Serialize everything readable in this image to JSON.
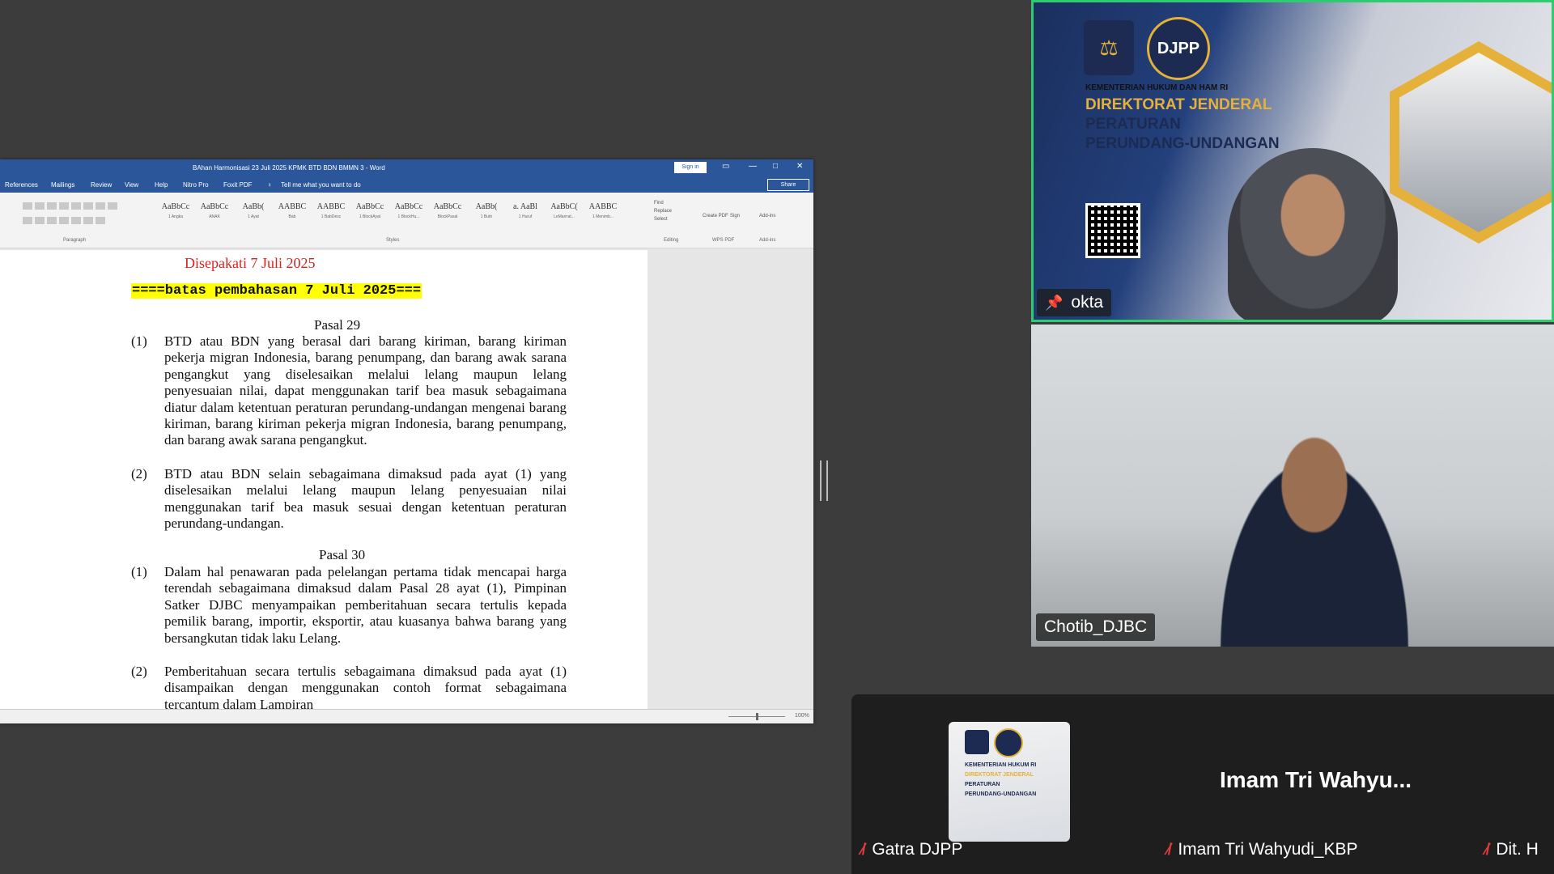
{
  "word": {
    "title": "BAhan Harmonisasi 23 Juli 2025 KPMK BTD BDN BMMN 3 - Word",
    "sign_in": "Sign in",
    "share": "Share",
    "menu": [
      "References",
      "Mailings",
      "Review",
      "View",
      "Help",
      "Nitro Pro",
      "Foxit PDF"
    ],
    "tell_me": "Tell me what you want to do",
    "styles": [
      {
        "sample": "AaBbCc",
        "name": "1 Angka"
      },
      {
        "sample": "AaBbCc",
        "name": "ANAK"
      },
      {
        "sample": "AaBb(",
        "name": "1 Ayat"
      },
      {
        "sample": "AABBC",
        "name": "Bab"
      },
      {
        "sample": "AABBC",
        "name": "1 BabDesc"
      },
      {
        "sample": "AaBbCc",
        "name": "1 BlockAyat"
      },
      {
        "sample": "AaBbCc",
        "name": "1 BlockHu..."
      },
      {
        "sample": "AaBbCc",
        "name": "BlockPasal"
      },
      {
        "sample": "AaBb(",
        "name": "1 Butir"
      },
      {
        "sample": "a. AaBl",
        "name": "1 Huruf"
      },
      {
        "sample": "AaBbC(",
        "name": "LeMarrrat..."
      },
      {
        "sample": "AABBC",
        "name": "1 Menimb..."
      }
    ],
    "groups": {
      "paragraph": "Paragraph",
      "styles": "Styles",
      "editing": "Editing",
      "wps_pdf": "WPS PDF",
      "add_ins": "Add-ins"
    },
    "tools": {
      "find": "Find",
      "replace": "Replace",
      "select": "Select",
      "create_pdf": "Create PDF",
      "sign": "Sign",
      "add_ins": "Add-ins"
    },
    "zoom": "100%"
  },
  "document": {
    "agreed_line": "Disepakati 7 Juli 2025",
    "highlight_line": "====batas pembahasan 7 Juli 2025===",
    "pasal29": {
      "heading": "Pasal 29",
      "ayat": [
        {
          "num": "(1)",
          "text": "BTD atau BDN yang berasal dari barang kiriman, barang kiriman pekerja migran Indonesia, barang penumpang, dan barang awak sarana pengangkut yang diselesaikan melalui lelang maupun lelang penyesuaian nilai, dapat menggunakan tarif bea masuk sebagaimana diatur dalam ketentuan peraturan perundang-undangan mengenai barang kiriman, barang kiriman pekerja migran Indonesia, barang penumpang, dan barang awak sarana pengangkut."
        },
        {
          "num": "(2)",
          "text": "BTD atau BDN selain sebagaimana dimaksud pada ayat (1) yang diselesaikan melalui lelang maupun lelang penyesuaian nilai menggunakan tarif bea masuk sesuai dengan ketentuan peraturan perundang-undangan."
        }
      ]
    },
    "pasal30": {
      "heading": "Pasal 30",
      "ayat": [
        {
          "num": "(1)",
          "text": "Dalam hal penawaran pada pelelangan pertama tidak mencapai harga terendah sebagaimana dimaksud dalam Pasal 28 ayat (1), Pimpinan Satker DJBC menyampaikan pemberitahuan secara tertulis kepada pemilik barang, importir, eksportir, atau kuasanya bahwa barang yang bersangkutan tidak laku Lelang."
        },
        {
          "num": "(2)",
          "text": "Pemberitahuan secara tertulis sebagaimana dimaksud pada ayat (1) disampaikan dengan menggunakan contoh format sebagaimana tercantum dalam Lampiran"
        }
      ]
    }
  },
  "video": {
    "tile1": {
      "name": "okta",
      "bg_line1": "KEMENTERIAN HUKUM DAN HAM RI",
      "bg_line2": "DIREKTORAT JENDERAL",
      "bg_line3": "PERATURAN",
      "bg_line4": "PERUNDANG-UNDANGAN",
      "logo_text": "DJPP",
      "active_border": "#2ecc71"
    },
    "tile2": {
      "name": "Chotib_DJBC"
    }
  },
  "participants": {
    "big_name": "Imam Tri Wahyu...",
    "thumb_lines": [
      "KEMENTERIAN HUKUM RI",
      "DIREKTORAT JENDERAL",
      "PERATURAN",
      "PERUNDANG-UNDANGAN"
    ],
    "list": [
      {
        "name": "Gatra DJPP",
        "icon": "mic-muted-icon"
      },
      {
        "name": "Imam Tri Wahyudi_KBP",
        "icon": "mic-muted-icon"
      },
      {
        "name": "Dit. H",
        "icon": "mic-muted-icon"
      }
    ]
  }
}
